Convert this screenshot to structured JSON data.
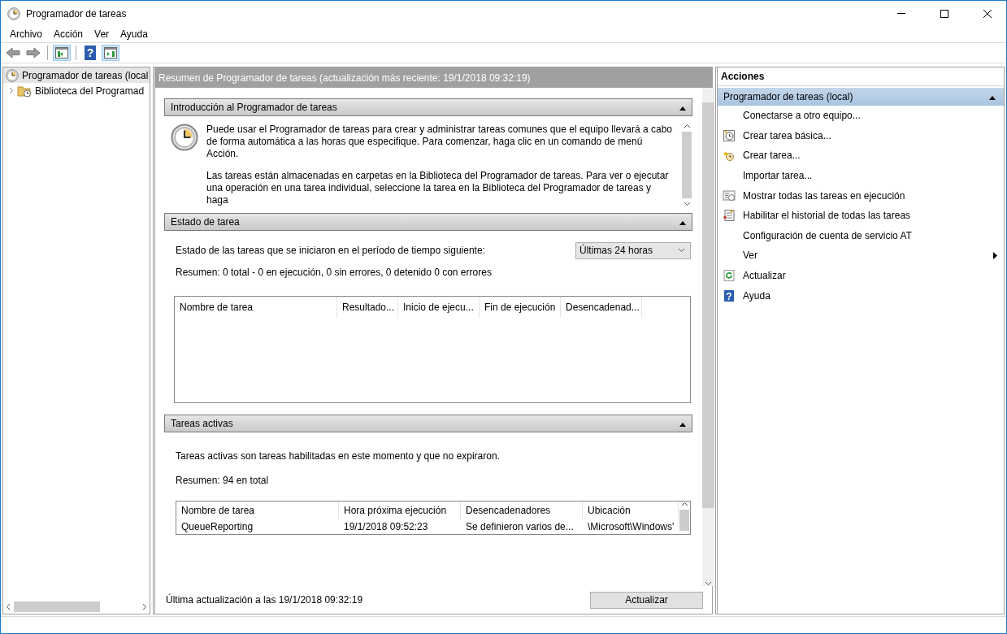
{
  "window": {
    "title": "Programador de tareas"
  },
  "menu": [
    "Archivo",
    "Acción",
    "Ver",
    "Ayuda"
  ],
  "tree": [
    {
      "label": "Programador de tareas (local",
      "selected": true,
      "expanded": true,
      "children": [
        {
          "label": "Biblioteca del Programad",
          "selected": false,
          "expanded": false
        }
      ]
    }
  ],
  "summary": {
    "header": "Resumen de Programador de tareas (actualización más reciente: 19/1/2018 09:32:19)",
    "intro": {
      "title": "Introducción al Programador de tareas",
      "expanded": true,
      "paragraphs": [
        "Puede usar el Programador de tareas para crear y administrar tareas comunes que el equipo llevará a cabo de forma automática a las horas que especifique. Para comenzar, haga clic en un comando de menú Acción.",
        "Las tareas están almacenadas en carpetas en la Biblioteca del Programador de tareas. Para ver o ejecutar una operación en una tarea individual, seleccione la tarea en la Biblioteca del Programador de tareas y haga"
      ]
    },
    "task_status": {
      "title": "Estado de tarea",
      "expanded": true,
      "label": "Estado de las tareas que se iniciaron en el período de tiempo siguiente:",
      "period": "Últimas 24 horas",
      "summary": "Resumen: 0 total - 0 en ejecución, 0 sin errores, 0 detenido  0 con errores",
      "table": {
        "columns": [
          "Nombre de tarea",
          "Resultado...",
          "Inicio de ejecu...",
          "Fin de ejecución",
          "Desencadenad..."
        ]
      }
    },
    "active_tasks": {
      "title": "Tareas activas",
      "expanded": true,
      "description": "Tareas activas son tareas habilitadas en este momento y que no expiraron.",
      "summary": "Resumen: 94 en total",
      "table": {
        "columns": [
          "Nombre de tarea",
          "Hora próxima ejecución",
          "Desencadenadores",
          "Ubicación"
        ],
        "rows": [
          [
            "QueueReporting",
            "19/1/2018 09:52:23",
            "Se definieron varios de...",
            "\\Microsoft\\Windows'"
          ]
        ]
      }
    },
    "footer": {
      "last_update": "Última actualización a las 19/1/2018 09:32:19",
      "button": "Actualizar"
    }
  },
  "actions": {
    "title": "Acciones",
    "group": {
      "label": "Programador de tareas (local)",
      "expanded": true
    },
    "items": [
      {
        "label": "Conectarse a otro equipo...",
        "submenu": false
      },
      {
        "label": "Crear tarea básica...",
        "submenu": false
      },
      {
        "label": "Crear tarea...",
        "submenu": false
      },
      {
        "label": "Importar tarea...",
        "submenu": false
      },
      {
        "label": "Mostrar todas las tareas en ejecución",
        "submenu": false
      },
      {
        "label": "Habilitar el historial de todas las tareas",
        "submenu": false
      },
      {
        "label": "Configuración de cuenta de servicio AT",
        "submenu": false
      },
      {
        "label": "Ver",
        "submenu": true
      },
      {
        "label": "Actualizar",
        "submenu": false
      },
      {
        "label": "Ayuda",
        "help_glyph": "?",
        "submenu": false
      }
    ]
  },
  "toolbar": {
    "help_glyph": "?"
  }
}
